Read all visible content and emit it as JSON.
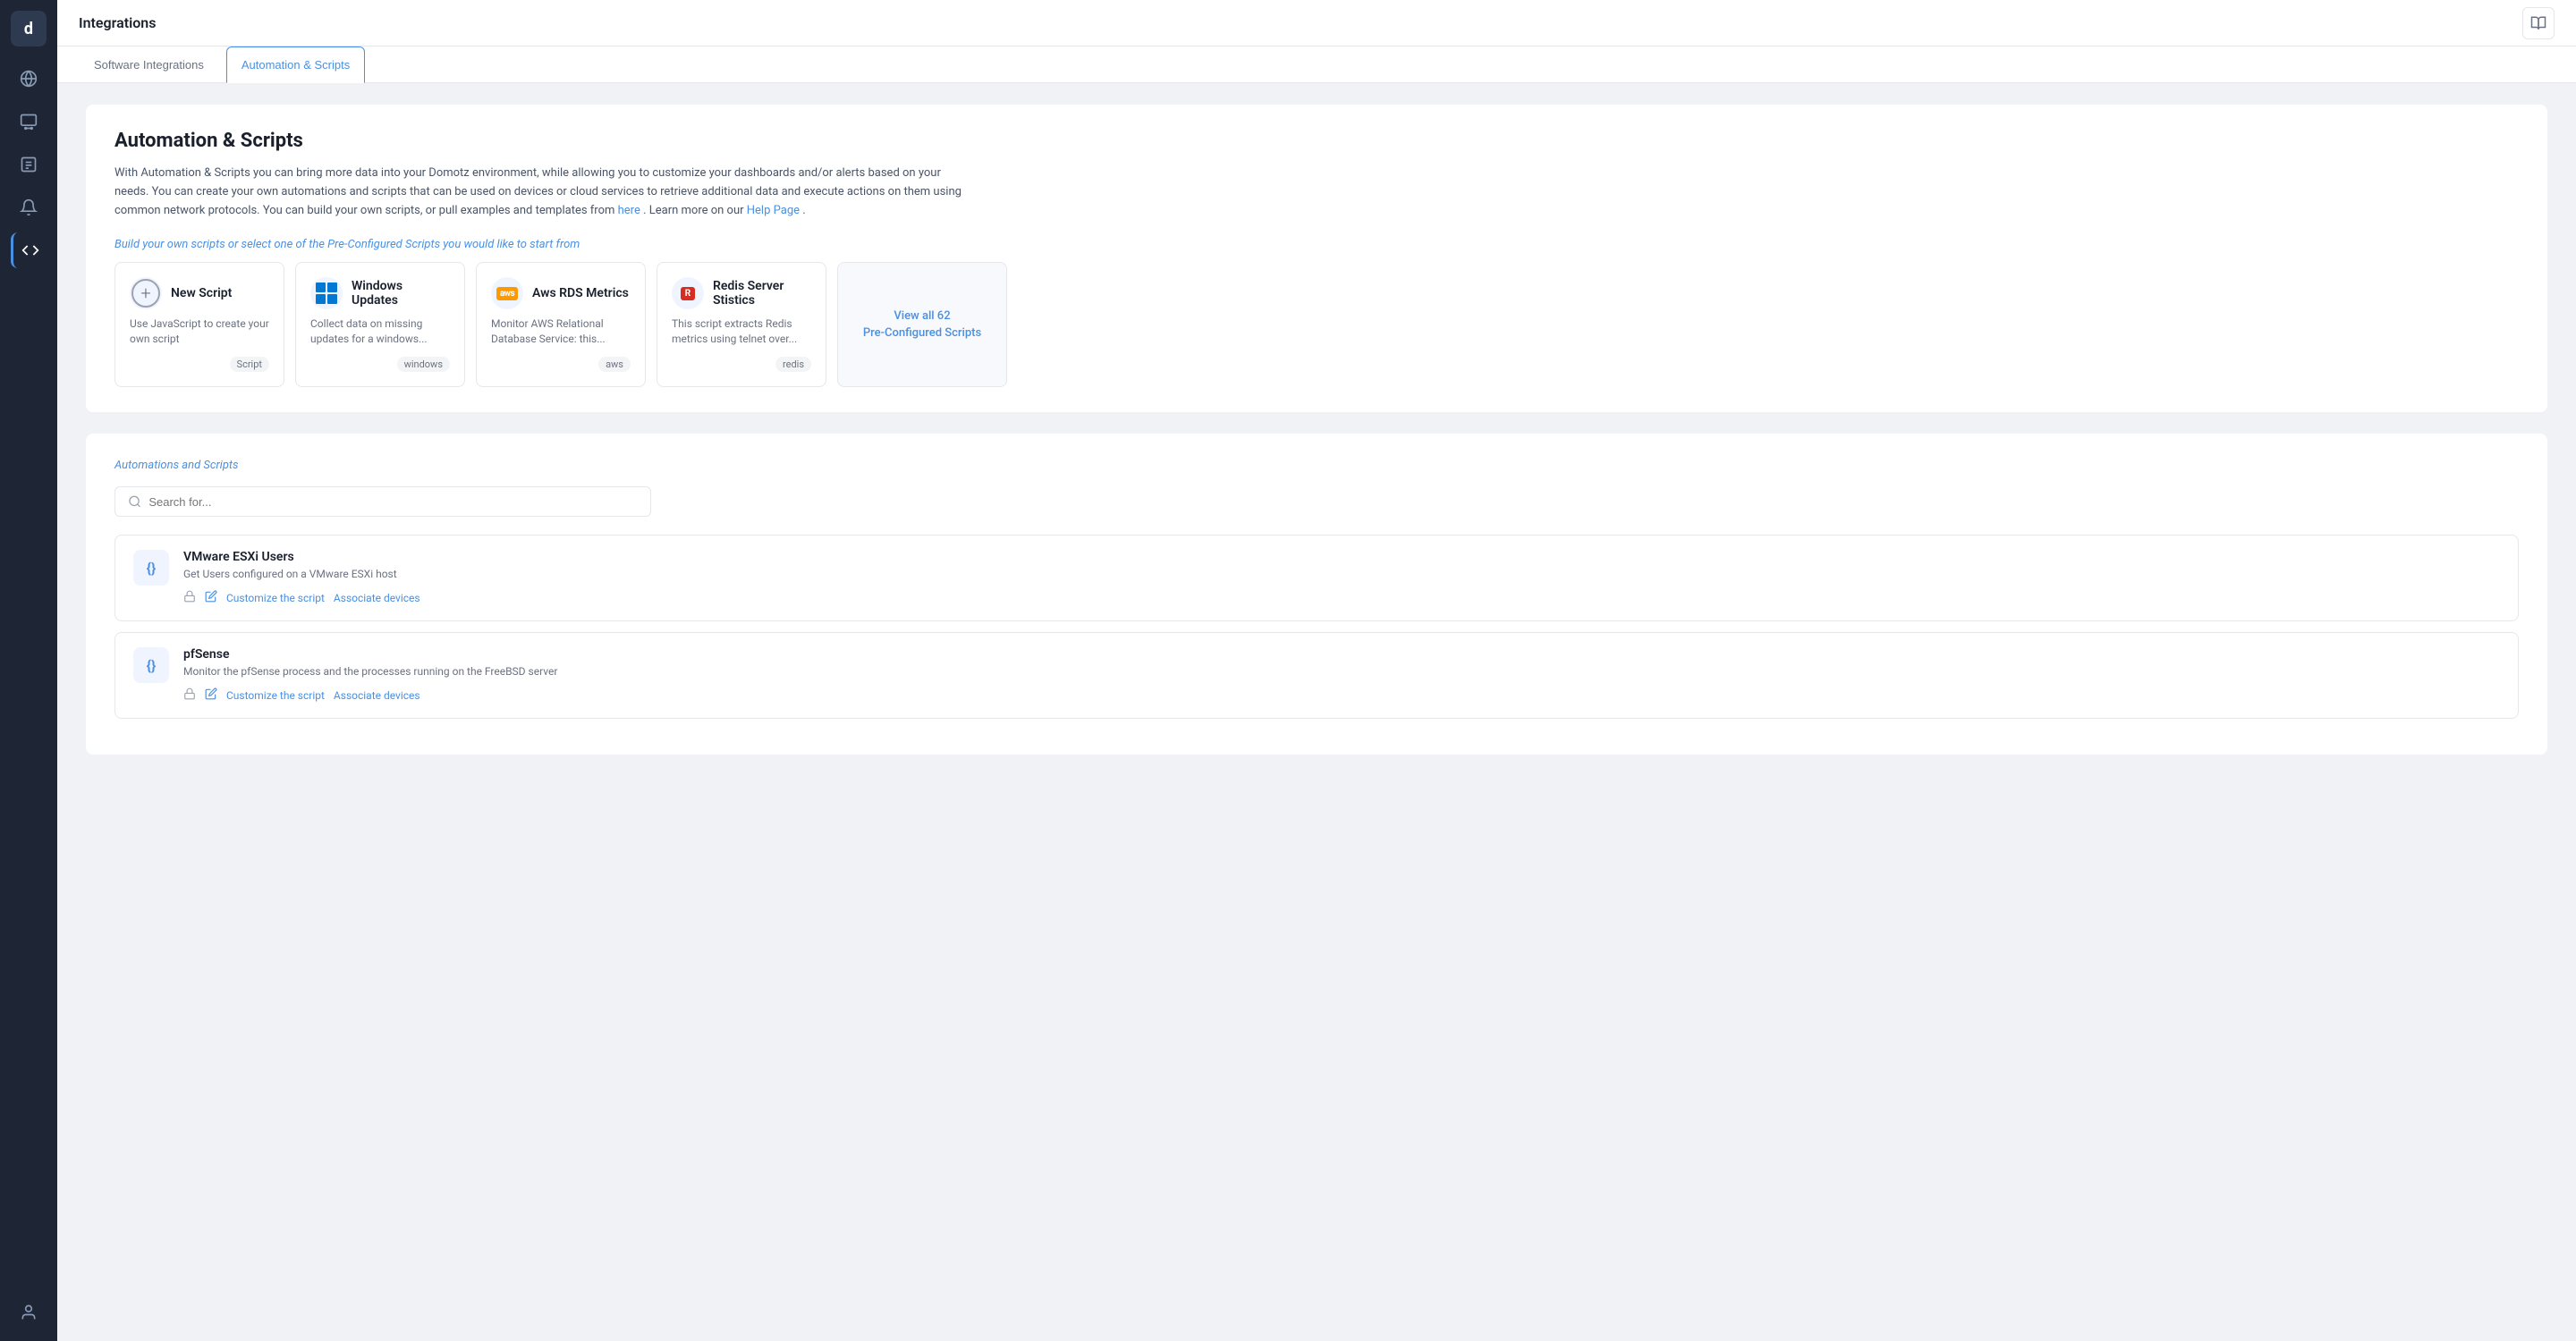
{
  "sidebar": {
    "logo": "d",
    "items": [
      {
        "id": "globe",
        "label": "Network",
        "active": false
      },
      {
        "id": "nodes",
        "label": "Devices",
        "active": false
      },
      {
        "id": "reports",
        "label": "Reports",
        "active": false
      },
      {
        "id": "alerts",
        "label": "Alerts",
        "active": false
      },
      {
        "id": "integrations",
        "label": "Integrations",
        "active": true
      },
      {
        "id": "user",
        "label": "Account",
        "active": false
      }
    ]
  },
  "topbar": {
    "title": "Integrations",
    "book_icon": "book-open-icon"
  },
  "tabs": [
    {
      "id": "software",
      "label": "Software Integrations",
      "active": false
    },
    {
      "id": "automation",
      "label": "Automation & Scripts",
      "active": true
    }
  ],
  "main": {
    "heading": "Automation & Scripts",
    "description_1": "With Automation & Scripts you can bring more data into your Domotz environment, while allowing you to customize your dashboards and/or alerts based on your needs. You can create your own automations and scripts that can be used on devices or cloud services to retrieve additional data and execute actions on them using common network protocols. You can build your own scripts, or pull examples and templates from ",
    "description_link": "here",
    "description_2": ". Learn more on our ",
    "help_link": "Help Page",
    "description_end": ".",
    "preconfigured_label": "Build your own scripts or select one of the Pre-Configured Scripts you would like to start from",
    "script_cards": [
      {
        "id": "new-script",
        "name": "New Script",
        "desc": "Use JavaScript to create your own script",
        "tag": "Script",
        "icon_type": "plus"
      },
      {
        "id": "windows-updates",
        "name": "Windows Updates",
        "desc": "Collect data on missing updates for a windows...",
        "tag": "windows",
        "icon_type": "windows"
      },
      {
        "id": "aws-rds",
        "name": "Aws RDS Metrics",
        "desc": "Monitor AWS Relational Database Service: this...",
        "tag": "aws",
        "icon_type": "aws"
      },
      {
        "id": "redis-server",
        "name": "Redis Server Stistics",
        "desc": "This script extracts Redis metrics using telnet over...",
        "tag": "redis",
        "icon_type": "redis"
      }
    ],
    "view_all_count": "View all 62",
    "view_all_sub": "Pre-Configured Scripts",
    "automations_label": "Automations and Scripts",
    "search_placeholder": "Search for...",
    "script_list": [
      {
        "id": "vmware",
        "name": "VMware ESXi Users",
        "desc": "Get Users configured on a VMware ESXi host",
        "customize_label": "Customize the script",
        "associate_label": "Associate devices"
      },
      {
        "id": "pfsense",
        "name": "pfSense",
        "desc": "Monitor the pfSense process and the processes running on the FreeBSD server",
        "customize_label": "Customize the script",
        "associate_label": "Associate devices"
      }
    ]
  }
}
